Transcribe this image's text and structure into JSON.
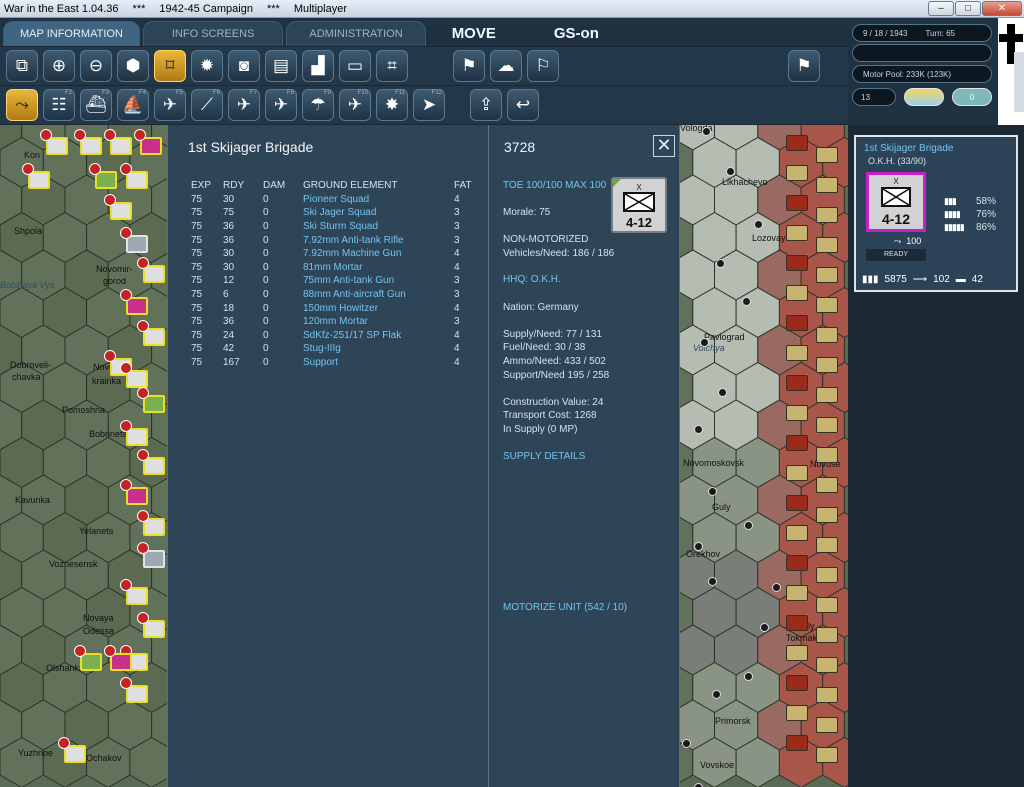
{
  "window": {
    "app_title": "War in the East 1.04.36",
    "separator1": "***",
    "campaign": "1942-45 Campaign",
    "separator2": "***",
    "mode": "Multiplayer"
  },
  "menu": {
    "tabs": [
      "MAP INFORMATION",
      "INFO SCREENS",
      "ADMINISTRATION"
    ],
    "move_label": "MOVE",
    "gs_label": "GS-on"
  },
  "status": {
    "date": "9 / 18 / 1943",
    "turn": "Turn: 65",
    "motor_pool": "Motor Pool: 233K (123K)",
    "weather_value": "13",
    "zero_value": "0"
  },
  "toolbar_row2_keys": [
    "F1",
    "F2",
    "F3",
    "F4",
    "F5",
    "F6",
    "F7",
    "F8",
    "F9",
    "F10",
    "F11",
    "F12"
  ],
  "map_labels": [
    {
      "t": "Kon"
    },
    {
      "t": "Shpola"
    },
    {
      "t": "Novomir-"
    },
    {
      "t": "gorod"
    },
    {
      "t": "Bolshaya Vys"
    },
    {
      "t": "Dobroveli-"
    },
    {
      "t": "chavka"
    },
    {
      "t": "Novou-"
    },
    {
      "t": "krainka"
    },
    {
      "t": "Pomoshna"
    },
    {
      "t": "Bobrinets"
    },
    {
      "t": "Kavunka"
    },
    {
      "t": "Yelanets"
    },
    {
      "t": "Voznesensk"
    },
    {
      "t": "Novaya"
    },
    {
      "t": "Odessa"
    },
    {
      "t": "Olshanka"
    },
    {
      "t": "Yuzhnoe"
    },
    {
      "t": "Ochakov"
    },
    {
      "t": "Vologda"
    },
    {
      "t": "Likhachevo"
    },
    {
      "t": "Lozovaya"
    },
    {
      "t": "Pavlograd"
    },
    {
      "t": "Novomoskovsk"
    },
    {
      "t": "Guly"
    },
    {
      "t": "Orekhov"
    },
    {
      "t": "Primorsk"
    },
    {
      "t": "Tokmak"
    },
    {
      "t": "Vesely"
    },
    {
      "t": "Novose"
    },
    {
      "t": "Vovskoe"
    },
    {
      "t": "Volchya"
    }
  ],
  "detail": {
    "unit_name": "1st Skijager Brigade",
    "unit_id": "3728",
    "close": "✕",
    "headers": [
      "EXP",
      "RDY",
      "DAM",
      "GROUND ELEMENT",
      "FAT"
    ],
    "rows": [
      [
        "75",
        "30",
        "0",
        "Pioneer Squad",
        "4"
      ],
      [
        "75",
        "75",
        "0",
        "Ski Jager Squad",
        "3"
      ],
      [
        "75",
        "36",
        "0",
        "Ski Sturm Squad",
        "3"
      ],
      [
        "75",
        "36",
        "0",
        "7.92mm Anti-tank Rifle",
        "3"
      ],
      [
        "75",
        "30",
        "0",
        "7.92mm Machine Gun",
        "4"
      ],
      [
        "75",
        "30",
        "0",
        "81mm Mortar",
        "4"
      ],
      [
        "75",
        "12",
        "0",
        "75mm Anti-tank Gun",
        "3"
      ],
      [
        "75",
        "6",
        "0",
        "88mm Anti-aircraft Gun",
        "3"
      ],
      [
        "75",
        "18",
        "0",
        "150mm Howitzer",
        "4"
      ],
      [
        "75",
        "36",
        "0",
        "120mm Mortar",
        "3"
      ],
      [
        "75",
        "24",
        "0",
        "SdKfz-251/17 SP Flak",
        "4"
      ],
      [
        "75",
        "42",
        "0",
        "Stug-IIIg",
        "4"
      ],
      [
        "75",
        "167",
        "0",
        "Support",
        "4"
      ]
    ],
    "toe": "TOE 100/100 MAX 100",
    "morale": "Morale:   75",
    "motorization": "NON-MOTORIZED",
    "vehicles": "Vehicles/Need:   186 / 186",
    "hhq": "HHQ: O.K.H.",
    "nation": "Nation:   Germany",
    "supply": "Supply/Need:   77 / 131",
    "fuel": "Fuel/Need:        30 / 38",
    "ammo": "Ammo/Need:   433 / 502",
    "support": "Support/Need     195 / 258",
    "construction": "Construction Value:   24",
    "transport": "Transport Cost:      1268",
    "in_supply": "In Supply (0 MP)",
    "supply_details": "SUPPLY DETAILS",
    "motorize": "MOTORIZE UNIT (542 / 10)",
    "counter_size": "X",
    "counter_value": "4-12"
  },
  "card": {
    "name": "1st Skijager Brigade",
    "hq": "O.K.H.  (33/90)",
    "size": "X",
    "value": "4-12",
    "pct1": "58%",
    "pct2": "76%",
    "pct3": "86%",
    "strength": "100",
    "ready": "READY",
    "men": "5875",
    "guns": "102",
    "afv": "42"
  },
  "colors": {
    "panel": "#2e4457",
    "link": "#72c4f0",
    "selected_tool": "#e8b83a",
    "counter_border": "#e8e020",
    "unit_highlight": "#c820c8"
  }
}
